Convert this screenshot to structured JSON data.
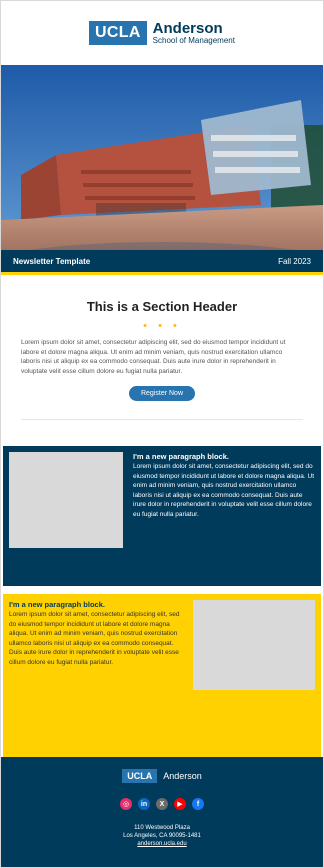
{
  "brand": {
    "ucla": "UCLA",
    "name": "Anderson",
    "subtitle": "School of Management",
    "colors": {
      "primary": "#003b5c",
      "accent": "#2774ae",
      "gold": "#ffd100"
    }
  },
  "hero": {
    "left_label": "Newsletter Template",
    "right_label": "Fall 2023"
  },
  "section": {
    "title": "This is a Section Header",
    "body": "Lorem ipsum dolor sit amet, consectetur adipiscing elit, sed do eiusmod tempor incididunt ut labore et dolore magna aliqua. Ut enim ad minim veniam, quis nostrud exercitation ullamco laboris nisi ut aliquip ex ea commodo consequat. Duis aute irure dolor in reprehenderit in voluptate velit esse cillum dolore eu fugiat nulla pariatur.",
    "button": "Register Now"
  },
  "dark_block": {
    "heading": "I'm a new paragraph block.",
    "body": "Lorem ipsum dolor sit amet, consectetur adipiscing elit, sed do eiusmod tempor incididunt ut labore et dolore magna aliqua. Ut enim ad minim veniam, quis nostrud exercitation ullamco laboris nisi ut aliquip ex ea commodo consequat. Duis aute irure dolor in reprehenderit in voluptate velit esse cillum dolore eu fugiat nulla pariatur."
  },
  "yellow_block": {
    "heading": "I'm a new paragraph block.",
    "body": "Lorem ipsum dolor sit amet, consectetur adipiscing elit, sed do eiusmod tempor incididunt ut labore et dolore magna aliqua. Ut enim ad minim veniam, quis nostrud exercitation ullamco laboris nisi ut aliquip ex ea commodo consequat. Duis aute irure dolor in reprehenderit in voluptate velit esse cillum dolore eu fugiat nulla pariatur."
  },
  "footer": {
    "ucla": "UCLA",
    "name": "Anderson",
    "socials": [
      {
        "icon": "instagram-icon",
        "glyph": "◎",
        "color": "#e1306c"
      },
      {
        "icon": "linkedin-icon",
        "glyph": "in",
        "color": "#0a66c2"
      },
      {
        "icon": "x-icon",
        "glyph": "X",
        "color": "#6b6b6b"
      },
      {
        "icon": "youtube-icon",
        "glyph": "▶",
        "color": "#ff0000"
      },
      {
        "icon": "facebook-icon",
        "glyph": "f",
        "color": "#1877f2"
      }
    ],
    "address_line1": "110 Westwood Plaza",
    "address_line2": "Los Angeles, CA 90095-1481",
    "website": "anderson.ucla.edu"
  }
}
